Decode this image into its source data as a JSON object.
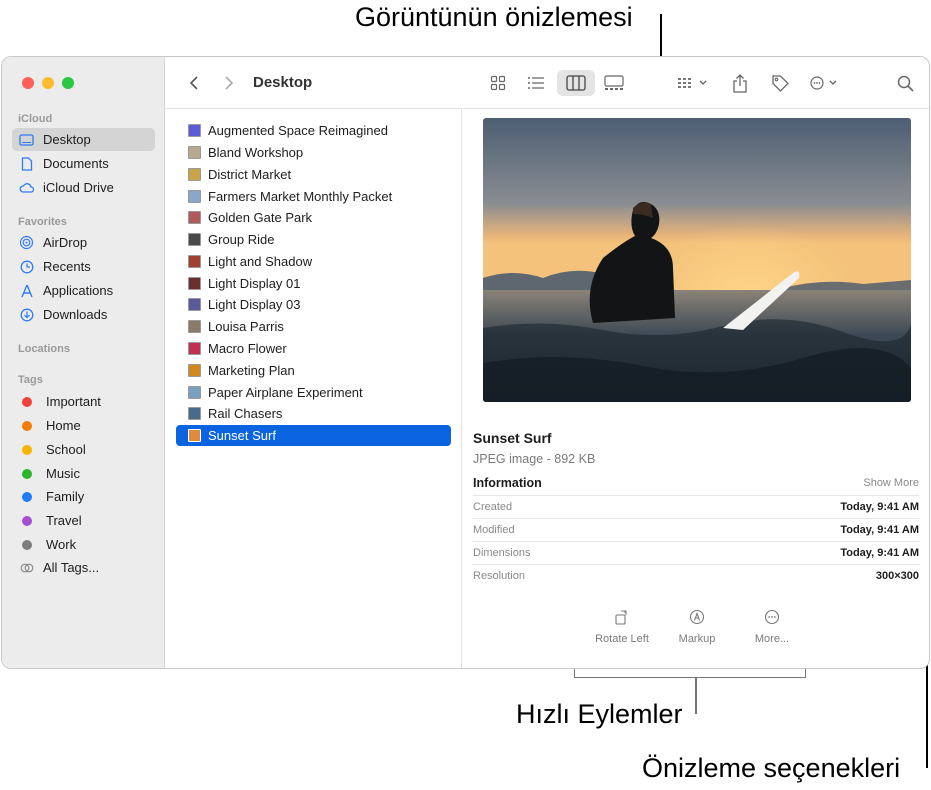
{
  "annotations": {
    "preview": "Görüntünün önizlemesi",
    "quick_actions": "Hızlı Eylemler",
    "preview_options": "Önizleme seçenekleri"
  },
  "window": {
    "title": "Desktop",
    "traffic_colors": [
      "#fe5f57",
      "#febc2e",
      "#28c840"
    ]
  },
  "sidebar": {
    "sections": {
      "icloud": "iCloud",
      "favorites": "Favorites",
      "locations": "Locations",
      "tags": "Tags"
    },
    "icloud_items": [
      {
        "label": "Desktop",
        "icon": "desktop-icon",
        "active": true
      },
      {
        "label": "Documents",
        "icon": "document-icon"
      },
      {
        "label": "iCloud Drive",
        "icon": "cloud-icon"
      }
    ],
    "favorite_items": [
      {
        "label": "AirDrop",
        "icon": "airdrop-icon"
      },
      {
        "label": "Recents",
        "icon": "clock-icon"
      },
      {
        "label": "Applications",
        "icon": "applications-icon"
      },
      {
        "label": "Downloads",
        "icon": "download-icon"
      }
    ],
    "tags": [
      {
        "label": "Important",
        "color": "#f2413a"
      },
      {
        "label": "Home",
        "color": "#f57b0a"
      },
      {
        "label": "School",
        "color": "#f6b500"
      },
      {
        "label": "Music",
        "color": "#2bb52b"
      },
      {
        "label": "Family",
        "color": "#1e7cf5"
      },
      {
        "label": "Travel",
        "color": "#a64fd0"
      },
      {
        "label": "Work",
        "color": "#7d7d7d"
      },
      {
        "label": "All Tags...",
        "color": null
      }
    ]
  },
  "files": [
    {
      "name": "Augmented Space Reimagined",
      "color": "#5b5bd6"
    },
    {
      "name": "Bland Workshop",
      "color": "#b8a890"
    },
    {
      "name": "District Market",
      "color": "#c7a34a"
    },
    {
      "name": "Farmers Market Monthly Packet",
      "color": "#8aa7c9"
    },
    {
      "name": "Golden Gate Park",
      "color": "#b05a5a"
    },
    {
      "name": "Group Ride",
      "color": "#4a4a4a"
    },
    {
      "name": "Light and Shadow",
      "color": "#a04030"
    },
    {
      "name": "Light Display 01",
      "color": "#6a3030"
    },
    {
      "name": "Light Display 03",
      "color": "#5a5a9a"
    },
    {
      "name": "Louisa Parris",
      "color": "#8a7a6a"
    },
    {
      "name": "Macro Flower",
      "color": "#c03050"
    },
    {
      "name": "Marketing Plan",
      "color": "#d08a20"
    },
    {
      "name": "Paper Airplane Experiment",
      "color": "#7aa0c0"
    },
    {
      "name": "Rail Chasers",
      "color": "#4a6a8a"
    },
    {
      "name": "Sunset Surf",
      "color": "#e08a40",
      "selected": true
    }
  ],
  "preview": {
    "title": "Sunset Surf",
    "subtitle": "JPEG image - 892 KB",
    "info_heading": "Information",
    "show_more": "Show More",
    "rows": [
      {
        "key": "Created",
        "value": "Today, 9:41 AM"
      },
      {
        "key": "Modified",
        "value": "Today, 9:41 AM"
      },
      {
        "key": "Dimensions",
        "value": "Today, 9:41 AM"
      },
      {
        "key": "Resolution",
        "value": "300×300"
      }
    ],
    "quick_actions": [
      {
        "label": "Rotate Left",
        "icon": "rotate-left-icon"
      },
      {
        "label": "Markup",
        "icon": "markup-icon"
      },
      {
        "label": "More...",
        "icon": "more-icon"
      }
    ]
  }
}
